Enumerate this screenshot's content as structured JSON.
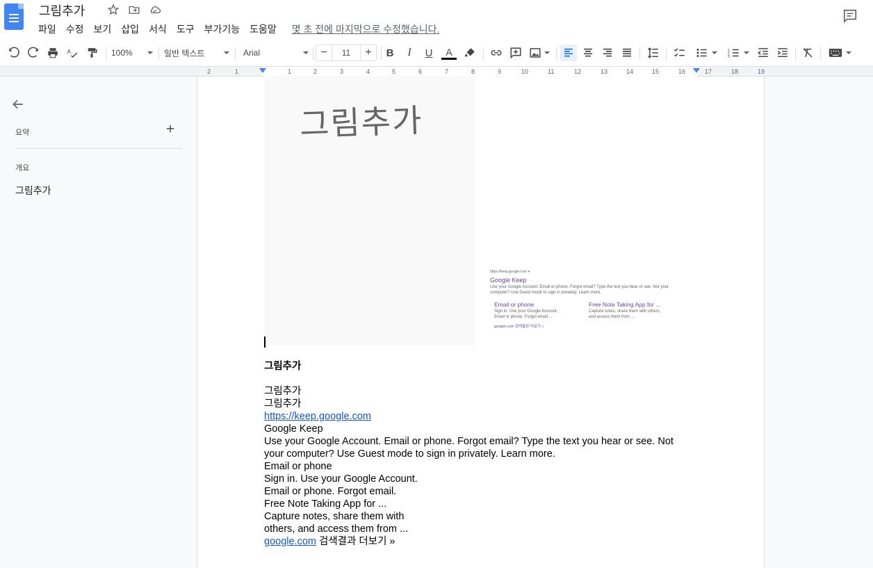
{
  "app": {
    "doc_title": "그림추가",
    "last_edit": "몇 초 전에 마지막으로 수정했습니다."
  },
  "menu": [
    "파일",
    "수정",
    "보기",
    "삽입",
    "서식",
    "도구",
    "부가기능",
    "도움말"
  ],
  "toolbar": {
    "zoom": "100%",
    "style": "일반 텍스트",
    "font": "Arial",
    "font_size": "11",
    "minus": "−",
    "plus": "+"
  },
  "ruler": {
    "labels": [
      "2",
      "1",
      "1",
      "2",
      "3",
      "4",
      "5",
      "6",
      "7",
      "8",
      "9",
      "10",
      "11",
      "12",
      "13",
      "14",
      "15",
      "16",
      "17",
      "18",
      "19"
    ]
  },
  "sidebar": {
    "summary_label": "요약",
    "outline_label": "개요",
    "outline_items": [
      "그림추가"
    ]
  },
  "image_right": {
    "url_line": "https://keep.google.com ▾",
    "title": "Google Keep",
    "snippet": "Use your Google Account. Email or phone. Forgot email? Type the text you hear or see. Not your computer? Use Guest mode to sign in privately. Learn more.",
    "sub1_title": "Email or phone",
    "sub1_text": "Sign in. Use your Google Account. Email or phone. Forgot email ...",
    "sub2_title": "Free Note Taking App for ...",
    "sub2_text": "Capture notes, share them with others, and access them from ...",
    "more": "google.com 검색결과 더보기 »"
  },
  "handwriting": "그림추가",
  "document": {
    "heading": "그림추가",
    "lines": [
      "그림추가",
      "그림추가"
    ],
    "link1": "https://keep.google.com",
    "body_lines": [
      "Google Keep",
      "Use your Google Account. Email or phone. Forgot email? Type the text you hear or see. Not your computer? Use Guest mode to sign in privately. Learn more.",
      "Email or phone",
      "Sign in. Use your Google Account.",
      "Email or phone. Forgot email.",
      "Free Note Taking App for ...",
      "Capture notes, share them with",
      "others, and access them from ..."
    ],
    "link2": "google.com",
    "link2_suffix": " 검색결과 더보기 »"
  },
  "colors": {
    "accent": "#1a73e8",
    "docs_blue": "#4285f4",
    "link": "#1155cc"
  }
}
